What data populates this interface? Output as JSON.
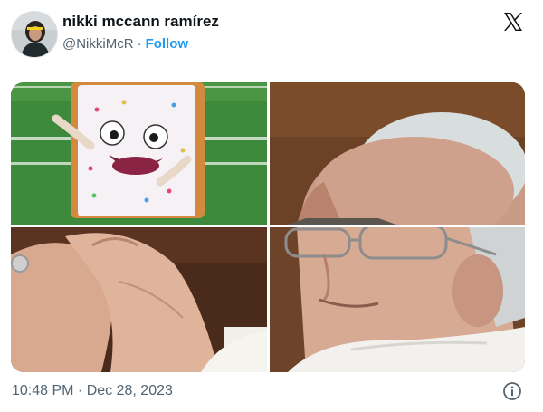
{
  "tweet": {
    "author": {
      "display_name": "nikki mccann ramírez",
      "handle": "@NikkiMcR",
      "separator": "·",
      "follow_label": "Follow"
    },
    "media": {
      "layout": "2x2-grid",
      "panels": [
        "pastry-mascot-on-football-field",
        "elderly-man-in-glasses-profile",
        "hands-holding-small-object",
        "elderly-man-in-glasses-closeup"
      ]
    },
    "timestamp": "10:48 PM · Dec 28, 2023",
    "icons": {
      "brand": "x-logo-icon",
      "info": "info-icon"
    }
  },
  "colors": {
    "text": "#0f1419",
    "secondary": "#536471",
    "accent": "#1d9bf0",
    "background": "#ffffff"
  }
}
